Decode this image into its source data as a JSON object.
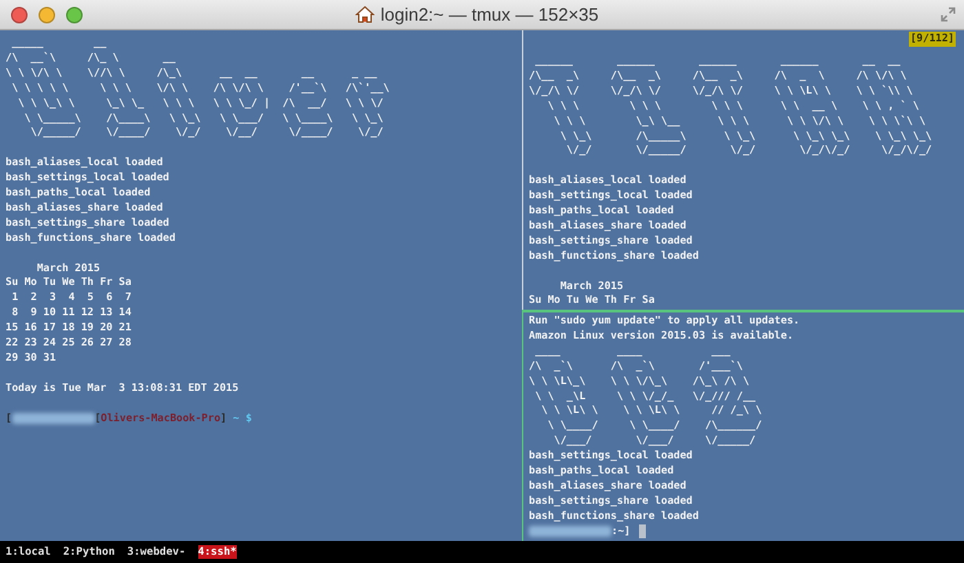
{
  "window": {
    "title": "login2:~ — tmux — 152×35"
  },
  "panes": [
    {
      "active": false,
      "blocks": [
        {
          "kind": "banner",
          "lines": [
            " _____        __",
            "/\\  __`\\     /\\_ \\       __",
            "\\ \\ \\/\\ \\    \\//\\ \\     /\\_\\      __  __       __      _ __",
            " \\ \\ \\ \\ \\     \\ \\ \\    \\/\\ \\    /\\ \\/\\ \\    /'__`\\   /\\`'__\\",
            "  \\ \\ \\_\\ \\     \\_\\ \\_   \\ \\ \\   \\ \\ \\_/ |  /\\  __/   \\ \\ \\/",
            "   \\ \\_____\\    /\\____\\   \\ \\_\\   \\ \\___/   \\ \\____\\   \\ \\_\\",
            "    \\/_____/    \\/____/    \\/_/    \\/__/     \\/____/    \\/_/"
          ]
        },
        {
          "kind": "blank"
        },
        {
          "kind": "lines",
          "lines": [
            "bash_aliases_local loaded",
            "bash_settings_local loaded",
            "bash_paths_local loaded",
            "bash_aliases_share loaded",
            "bash_settings_share loaded",
            "bash_functions_share loaded"
          ]
        },
        {
          "kind": "blank"
        },
        {
          "kind": "calendar",
          "lines": [
            "     March 2015",
            "Su Mo Tu We Th Fr Sa",
            " 1  2  3  4  5  6  7",
            " 8  9 10 11 12 13 14",
            "15 16 17 18 19 20 21",
            "22 23 24 25 26 27 28",
            "29 30 31"
          ]
        },
        {
          "kind": "blank"
        },
        {
          "kind": "lines",
          "lines": [
            "Today is Tue Mar  3 13:08:31 EDT 2015"
          ]
        },
        {
          "kind": "blank"
        },
        {
          "kind": "prompt",
          "segments": [
            {
              "kind": "text",
              "text": "[",
              "color": "#2a2a2a"
            },
            {
              "kind": "redacted"
            },
            {
              "kind": "text",
              "text": "[",
              "color": "#2a2a2a"
            },
            {
              "kind": "text",
              "text": "Olivers-MacBook-Pro",
              "color": "#7d1f2c"
            },
            {
              "kind": "text",
              "text": "]",
              "color": "#2a2a2a"
            },
            {
              "kind": "text",
              "text": " ~ $",
              "color": "#62c8f0"
            }
          ]
        }
      ]
    },
    {
      "active": false,
      "blocks": [
        {
          "kind": "badge",
          "text": "[9/112]"
        },
        {
          "kind": "banner",
          "lines": [
            " ______       ______       ______       ______       __  __",
            "/\\__  _\\     /\\__  _\\     /\\__  _\\     /\\  _  \\     /\\ \\/\\ \\",
            "\\/_/\\ \\/     \\/_/\\ \\/     \\/_/\\ \\/     \\ \\ \\L\\ \\    \\ \\ `\\\\ \\",
            "   \\ \\ \\        \\ \\ \\        \\ \\ \\      \\ \\  __ \\    \\ \\ , ` \\",
            "    \\ \\ \\        \\_\\ \\__      \\ \\ \\      \\ \\ \\/\\ \\    \\ \\ \\`\\ \\",
            "     \\ \\_\\       /\\_____\\      \\ \\_\\      \\ \\_\\ \\_\\    \\ \\_\\ \\_\\",
            "      \\/_/       \\/_____/       \\/_/       \\/_/\\/_/     \\/_/\\/_/"
          ]
        },
        {
          "kind": "blank"
        },
        {
          "kind": "lines",
          "lines": [
            "bash_aliases_local loaded",
            "bash_settings_local loaded",
            "bash_paths_local loaded",
            "bash_aliases_share loaded",
            "bash_settings_share loaded",
            "bash_functions_share loaded"
          ]
        },
        {
          "kind": "blank"
        },
        {
          "kind": "calendar",
          "lines": [
            "     March 2015",
            "Su Mo Tu We Th Fr Sa"
          ]
        }
      ]
    },
    {
      "active": true,
      "blocks": [
        {
          "kind": "lines",
          "lines": [
            "Run \"sudo yum update\" to apply all updates.",
            "Amazon Linux version 2015.03 is available."
          ]
        },
        {
          "kind": "banner",
          "lines": [
            " ____         ____           ___",
            "/\\  _`\\      /\\  _`\\       /'___`\\",
            "\\ \\ \\L\\_\\    \\ \\ \\/\\_\\    /\\_\\ /\\ \\",
            " \\ \\  _\\L     \\ \\ \\/_/_   \\/_/// /__",
            "  \\ \\ \\L\\ \\    \\ \\ \\L\\ \\     // /_\\ \\",
            "   \\ \\____/     \\ \\____/    /\\______/",
            "    \\/___/       \\/___/     \\/_____/"
          ]
        },
        {
          "kind": "lines",
          "lines": [
            "bash_settings_local loaded",
            "bash_paths_local loaded",
            "bash_aliases_share loaded",
            "bash_settings_share loaded",
            "bash_functions_share loaded"
          ]
        },
        {
          "kind": "prompt",
          "segments": [
            {
              "kind": "redacted"
            },
            {
              "kind": "text",
              "text": ":~]",
              "color": "#f2f2f2"
            },
            {
              "kind": "cursor"
            }
          ]
        }
      ]
    }
  ],
  "status_bar": {
    "windows": [
      {
        "label": "1:local",
        "selected": false
      },
      {
        "label": "2:Python",
        "selected": false
      },
      {
        "label": "3:webdev-",
        "selected": false
      },
      {
        "label": "4:ssh*",
        "selected": true
      }
    ]
  }
}
